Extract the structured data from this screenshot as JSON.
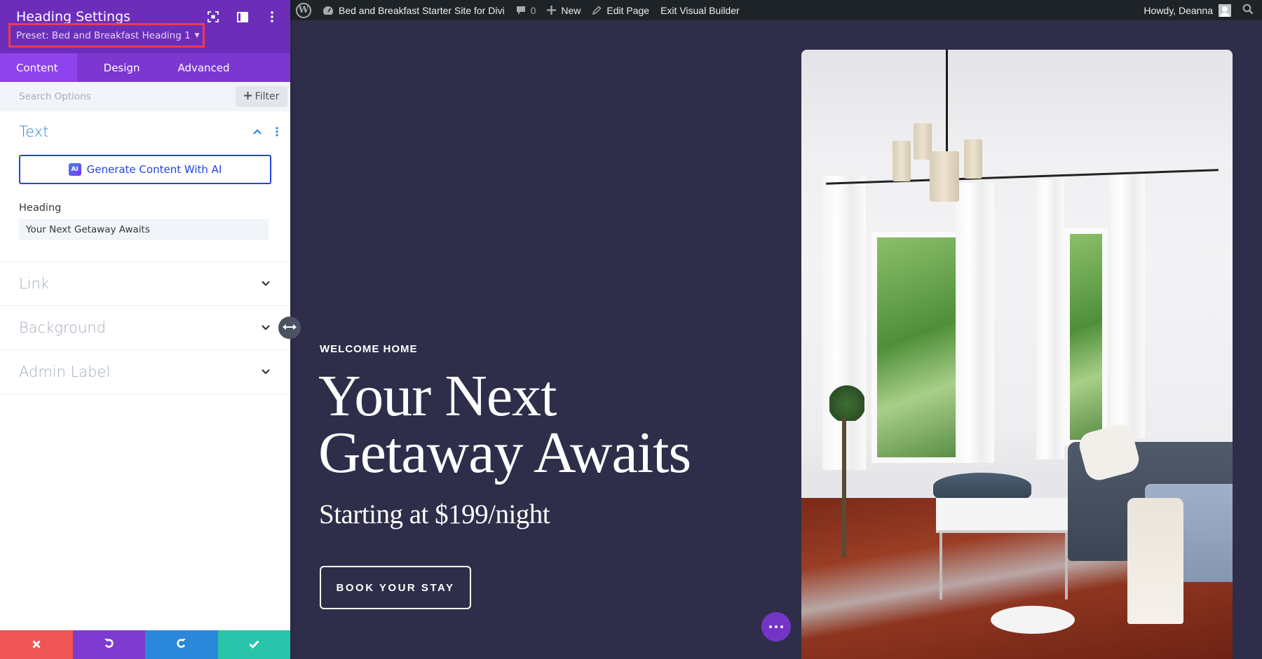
{
  "admin_bar": {
    "wp_logo": "wordpress-logo-icon",
    "site_name": "Bed and Breakfast Starter Site for Divi",
    "comments_count": "0",
    "new_label": "New",
    "edit_page_label": "Edit Page",
    "exit_builder_label": "Exit Visual Builder",
    "greeting": "Howdy, Deanna"
  },
  "panel": {
    "title": "Heading Settings",
    "preset_label": "Preset: Bed and Breakfast Heading 1",
    "header_icons": [
      "focus-icon",
      "split-view-icon",
      "more-vertical-icon"
    ],
    "tabs": [
      {
        "label": "Content",
        "active": true
      },
      {
        "label": "Design",
        "active": false
      },
      {
        "label": "Advanced",
        "active": false
      }
    ],
    "search_placeholder": "Search Options",
    "filter_label": "Filter",
    "text_section": {
      "title": "Text",
      "ai_button_label": "Generate Content With AI",
      "ai_badge": "AI",
      "heading_label": "Heading",
      "heading_value": "Your Next Getaway Awaits"
    },
    "collapsed_sections": [
      {
        "title": "Link"
      },
      {
        "title": "Background"
      },
      {
        "title": "Admin Label"
      }
    ],
    "bottom_actions": [
      "cancel",
      "undo",
      "redo",
      "save"
    ]
  },
  "hero": {
    "eyebrow": "WELCOME HOME",
    "title": "Your Next Getaway Awaits",
    "subtitle": "Starting at $199/night",
    "cta_label": "BOOK YOUR STAY"
  },
  "colors": {
    "panel_header": "#6c2eb9",
    "tab_bar": "#7b37cf",
    "active_tab": "#8e43ec",
    "preset_highlight": "#ee3a4f",
    "accent_blue": "#2b87da",
    "page_background": "#2e2e4a",
    "cancel": "#ef5555",
    "undo": "#7d3bcf",
    "redo": "#2b87da",
    "save": "#29c4a9"
  }
}
